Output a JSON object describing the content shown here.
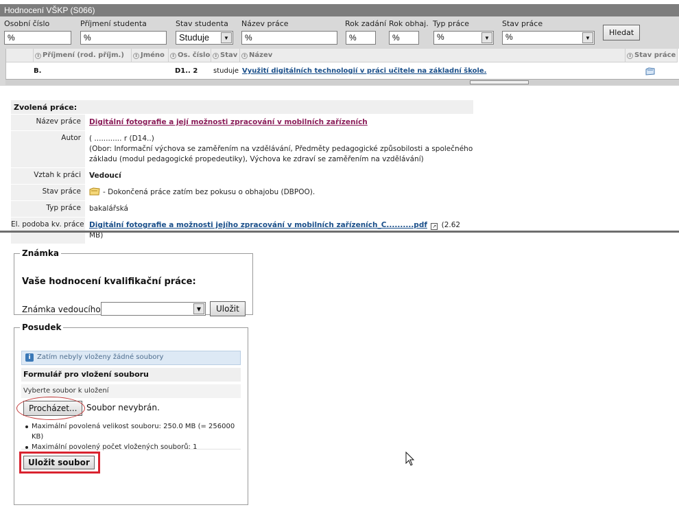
{
  "window": {
    "title": "Hodnocení VŠKP (S066)"
  },
  "filters": {
    "student_id": {
      "label": "Osobní číslo",
      "value": "%"
    },
    "surname": {
      "label": "Příjmení studenta",
      "value": "%"
    },
    "student_status": {
      "label": "Stav studenta",
      "value": "Studuje"
    },
    "thesis_title": {
      "label": "Název práce",
      "value": "%"
    },
    "year_assigned": {
      "label": "Rok zadání",
      "value": "%"
    },
    "year_defended": {
      "label": "Rok obhaj.",
      "value": "%"
    },
    "thesis_type": {
      "label": "Typ práce",
      "value": "%"
    },
    "thesis_status": {
      "label": "Stav práce",
      "value": "%"
    },
    "search_button": "Hledat"
  },
  "grid": {
    "columns": [
      "Příjmení (rod. příjm.)",
      "Jméno",
      "Os. číslo",
      "Stav",
      "Název",
      "Stav práce"
    ],
    "rows": [
      {
        "surname": "B.",
        "first_name": "",
        "student_id": "D1..  2",
        "status": "studuje",
        "title": "Využití digitálních technologií v práci učitele na základní škole.",
        "work_status_icon": "folder-icon"
      }
    ]
  },
  "selected_work": {
    "heading": "Zvolená práce:",
    "title": {
      "label": "Název práce",
      "value": "Digitální fotografie a její možnosti zpracování v mobilních zařízeních"
    },
    "author": {
      "label": "Autor",
      "name": "( ............ r (D14..)",
      "field": "(Obor: Informační výchova se zaměřením na vzdělávání, Předměty pedagogické způsobilosti a společného základu (modul pedagogické propedeutiky), Výchova ke zdraví se zaměřením na vzdělávání)"
    },
    "relation": {
      "label": "Vztah k práci",
      "value": "Vedoucí"
    },
    "status": {
      "label": "Stav práce",
      "value": "- Dokončená práce zatím bez pokusu o obhajobu (DBPOO)."
    },
    "type": {
      "label": "Typ práce",
      "value": "bakalářská"
    },
    "electronic": {
      "label": "El. podoba kv. práce",
      "file": "Digitální fotografie a možnosti jejího zpracování v mobilních zařízeních_C..........pdf",
      "size": "(2.62 MB)"
    }
  },
  "grade": {
    "legend": "Známka",
    "heading": "Vaše hodnocení kvalifikační práce:",
    "label": "Známka vedoucího",
    "value": "",
    "save_button": "Uložit"
  },
  "review": {
    "legend": "Posudek",
    "info": "Zatím nebyly vloženy žádné soubory",
    "form_heading": "Formulář pro vložení souboru",
    "select_label": "Vyberte soubor k uložení",
    "browse_button": "Procházet...",
    "no_file": "Soubor nevybrán.",
    "limits": [
      "Maximální povolená velikost souboru: 250.0 MB (= 256000 KB)",
      "Maximální povolený počet vložených souborů: 1"
    ],
    "save_button": "Uložit soubor"
  },
  "colors": {
    "highlight_red": "#d9232f",
    "link_blue": "#1a4f8a",
    "link_purple": "#8b1f5a"
  }
}
